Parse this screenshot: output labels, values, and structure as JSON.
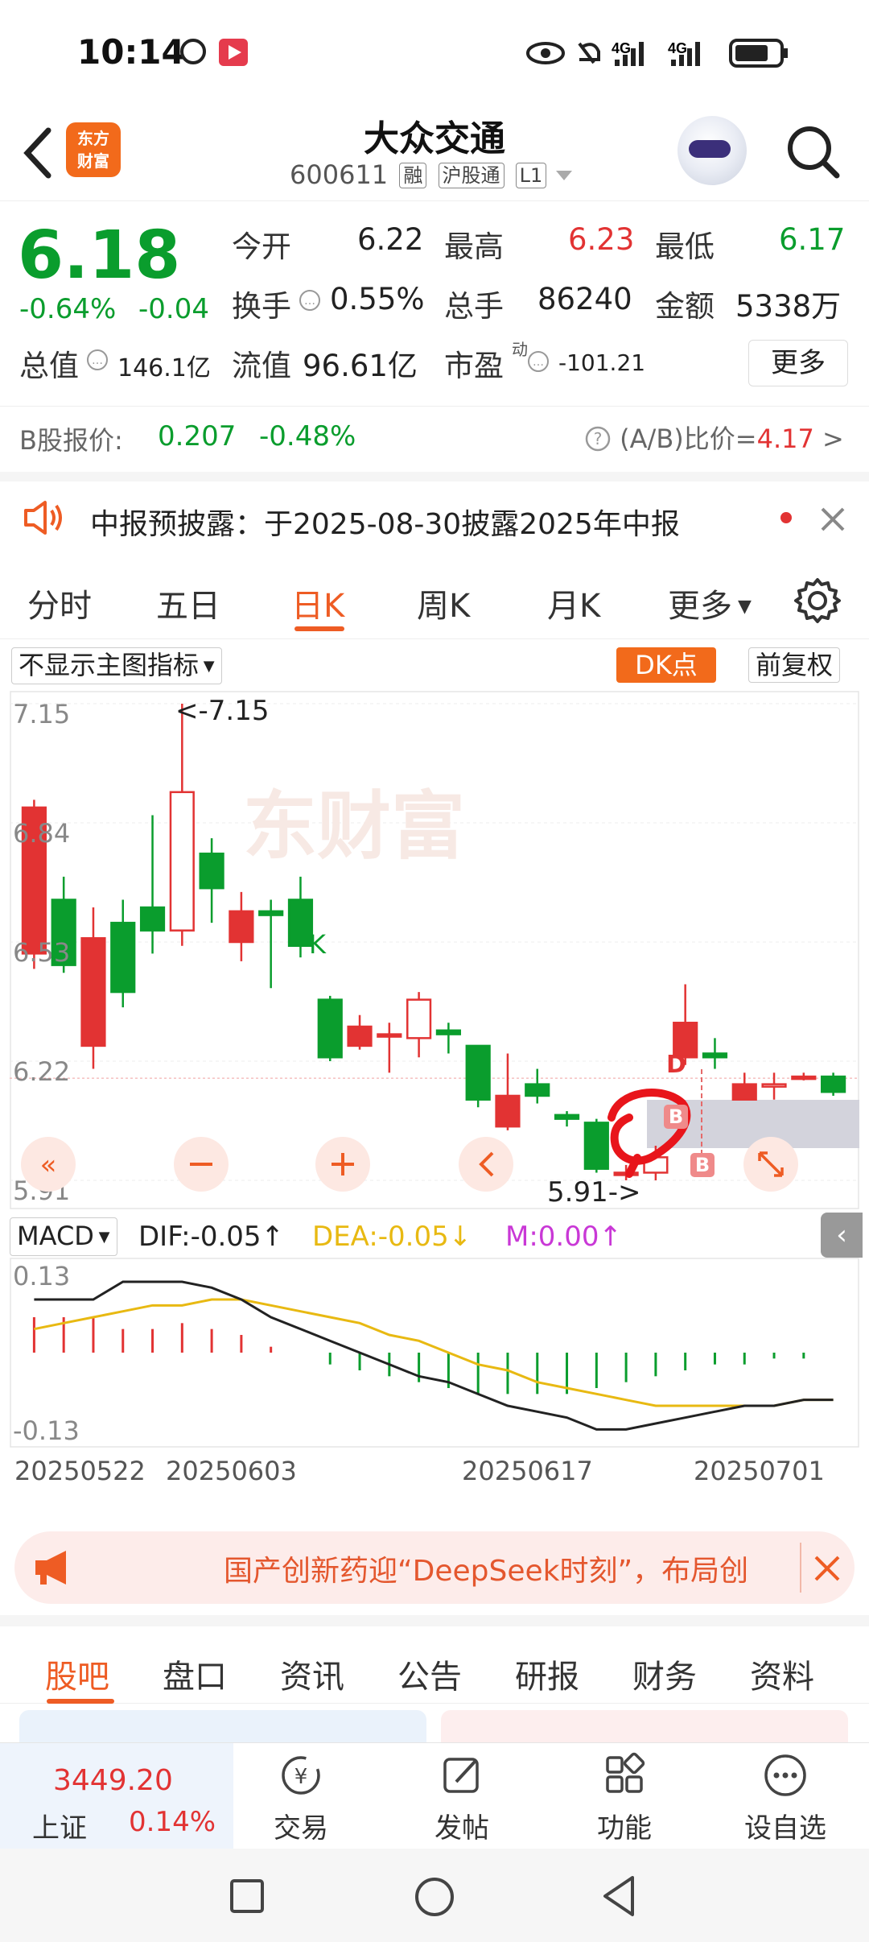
{
  "status_bar": {
    "time": "10:14"
  },
  "header": {
    "title": "大众交通",
    "code": "600611",
    "tags": [
      "融",
      "沪股通",
      "L1"
    ],
    "logo_text": [
      "东方",
      "财富"
    ]
  },
  "quote": {
    "price": "6.18",
    "change_pct": "-0.64%",
    "change_abs": "-0.04",
    "fields": [
      {
        "label": "今开",
        "value": "6.22",
        "color": "normal"
      },
      {
        "label": "最高",
        "value": "6.23",
        "color": "red"
      },
      {
        "label": "最低",
        "value": "6.17",
        "color": "green"
      },
      {
        "label": "换手",
        "value": "0.55%",
        "color": "normal"
      },
      {
        "label": "总手",
        "value": "86240",
        "color": "normal"
      },
      {
        "label": "金额",
        "value": "5338万",
        "color": "normal"
      },
      {
        "label": "总值",
        "value": "146.1亿",
        "color": "normal"
      },
      {
        "label": "流值",
        "value": "96.61亿",
        "color": "normal"
      },
      {
        "label": "市盈",
        "value": "-101.21",
        "color": "normal"
      }
    ],
    "pe_sup": "动",
    "more_label": "更多",
    "b_share_label": "B股报价:",
    "b_share_price": "0.207",
    "b_share_change": "-0.48%",
    "ab_ratio_label": "(A/B)比价=",
    "ab_ratio_value": "4.17"
  },
  "notice": {
    "text": "中报预披露：于2025-08-30披露2025年中报"
  },
  "chart_tabs": [
    "分时",
    "五日",
    "日K",
    "周K",
    "月K",
    "更多"
  ],
  "chart_tabs_active": "日K",
  "chart_controls": {
    "indicator_select": "不显示主图指标",
    "dk_label": "DK点",
    "adjust_label": "前复权"
  },
  "chart_data": {
    "type": "candlestick",
    "y_ticks": [
      "7.15",
      "6.84",
      "6.53",
      "6.22",
      "5.91"
    ],
    "ylim": [
      5.91,
      7.15
    ],
    "annotations": {
      "high": "<-7.15",
      "low": "5.91->",
      "k": "K",
      "d": "D",
      "b": "B"
    },
    "candles": [
      {
        "o": 6.5,
        "c": 6.88,
        "h": 6.9,
        "l": 6.46
      },
      {
        "o": 6.64,
        "c": 6.47,
        "h": 6.7,
        "l": 6.45
      },
      {
        "o": 6.26,
        "c": 6.54,
        "h": 6.62,
        "l": 6.2
      },
      {
        "o": 6.58,
        "c": 6.4,
        "h": 6.64,
        "l": 6.36
      },
      {
        "o": 6.62,
        "c": 6.56,
        "h": 6.86,
        "l": 6.5
      },
      {
        "o": 6.56,
        "c": 6.92,
        "h": 7.15,
        "l": 6.52
      },
      {
        "o": 6.76,
        "c": 6.67,
        "h": 6.8,
        "l": 6.58
      },
      {
        "o": 6.53,
        "c": 6.61,
        "h": 6.66,
        "l": 6.48
      },
      {
        "o": 6.61,
        "c": 6.6,
        "h": 6.64,
        "l": 6.41
      },
      {
        "o": 6.64,
        "c": 6.52,
        "h": 6.7,
        "l": 6.49
      },
      {
        "o": 6.38,
        "c": 6.23,
        "h": 6.39,
        "l": 6.22
      },
      {
        "o": 6.26,
        "c": 6.31,
        "h": 6.34,
        "l": 6.25
      },
      {
        "o": 6.29,
        "c": 6.29,
        "h": 6.32,
        "l": 6.19
      },
      {
        "o": 6.28,
        "c": 6.38,
        "h": 6.4,
        "l": 6.23
      },
      {
        "o": 6.3,
        "c": 6.29,
        "h": 6.32,
        "l": 6.24
      },
      {
        "o": 6.26,
        "c": 6.12,
        "h": 6.26,
        "l": 6.1
      },
      {
        "o": 6.05,
        "c": 6.13,
        "h": 6.24,
        "l": 6.04
      },
      {
        "o": 6.16,
        "c": 6.13,
        "h": 6.2,
        "l": 6.11
      },
      {
        "o": 6.08,
        "c": 6.07,
        "h": 6.09,
        "l": 6.05
      },
      {
        "o": 6.06,
        "c": 5.94,
        "h": 6.07,
        "l": 5.93
      },
      {
        "o": 5.93,
        "c": 5.93,
        "h": 5.95,
        "l": 5.91
      },
      {
        "o": 5.93,
        "c": 5.97,
        "h": 6.0,
        "l": 5.91
      },
      {
        "o": 6.23,
        "c": 6.32,
        "h": 6.42,
        "l": 6.21
      },
      {
        "o": 6.24,
        "c": 6.23,
        "h": 6.28,
        "l": 6.2
      },
      {
        "o": 6.12,
        "c": 6.16,
        "h": 6.19,
        "l": 6.12
      },
      {
        "o": 6.16,
        "c": 6.16,
        "h": 6.19,
        "l": 6.12
      },
      {
        "o": 6.18,
        "c": 6.18,
        "h": 6.19,
        "l": 6.17
      },
      {
        "o": 6.18,
        "c": 6.14,
        "h": 6.19,
        "l": 6.13
      }
    ]
  },
  "macd": {
    "selector": "MACD",
    "dif": "DIF:-0.05↑",
    "dea": "DEA:-0.05↓",
    "m": "M:0.00↑",
    "y_top": "0.13",
    "y_bottom": "-0.13",
    "dates": [
      "20250522",
      "20250603",
      "20250617",
      "20250701"
    ],
    "hist": [
      0.06,
      0.06,
      0.06,
      0.04,
      0.04,
      0.05,
      0.04,
      0.03,
      0.01,
      0.0,
      -0.02,
      -0.03,
      -0.04,
      -0.05,
      -0.06,
      -0.07,
      -0.07,
      -0.07,
      -0.07,
      -0.06,
      -0.05,
      -0.04,
      -0.03,
      -0.02,
      -0.02,
      -0.01,
      -0.01,
      0.0
    ],
    "dif_line": [
      0.09,
      0.09,
      0.09,
      0.12,
      0.12,
      0.12,
      0.11,
      0.09,
      0.06,
      0.04,
      0.02,
      0.0,
      -0.02,
      -0.04,
      -0.05,
      -0.07,
      -0.09,
      -0.1,
      -0.11,
      -0.13,
      -0.13,
      -0.12,
      -0.11,
      -0.1,
      -0.09,
      -0.09,
      -0.08,
      -0.08
    ],
    "dea_line": [
      0.04,
      0.05,
      0.06,
      0.07,
      0.08,
      0.08,
      0.09,
      0.09,
      0.08,
      0.07,
      0.06,
      0.05,
      0.03,
      0.02,
      0.0,
      -0.02,
      -0.03,
      -0.05,
      -0.06,
      -0.07,
      -0.08,
      -0.09,
      -0.09,
      -0.09,
      -0.09,
      -0.09,
      -0.08,
      -0.08
    ]
  },
  "ad": {
    "text": "国产创新药迎“DeepSeek时刻”，布局创"
  },
  "bottom_tabs": [
    "股吧",
    "盘口",
    "资讯",
    "公告",
    "研报",
    "财务",
    "资料"
  ],
  "bottom_tabs_active": "股吧",
  "bottom_bar": {
    "index_value": "3449.20",
    "index_name": "上证",
    "index_change": "0.14%",
    "items": [
      "交易",
      "发帖",
      "功能",
      "设自选"
    ]
  },
  "colors": {
    "up": "#e23333",
    "down": "#0a9d2d",
    "accent": "#ee5c24",
    "dea": "#e8b912",
    "m": "#c938d6"
  }
}
